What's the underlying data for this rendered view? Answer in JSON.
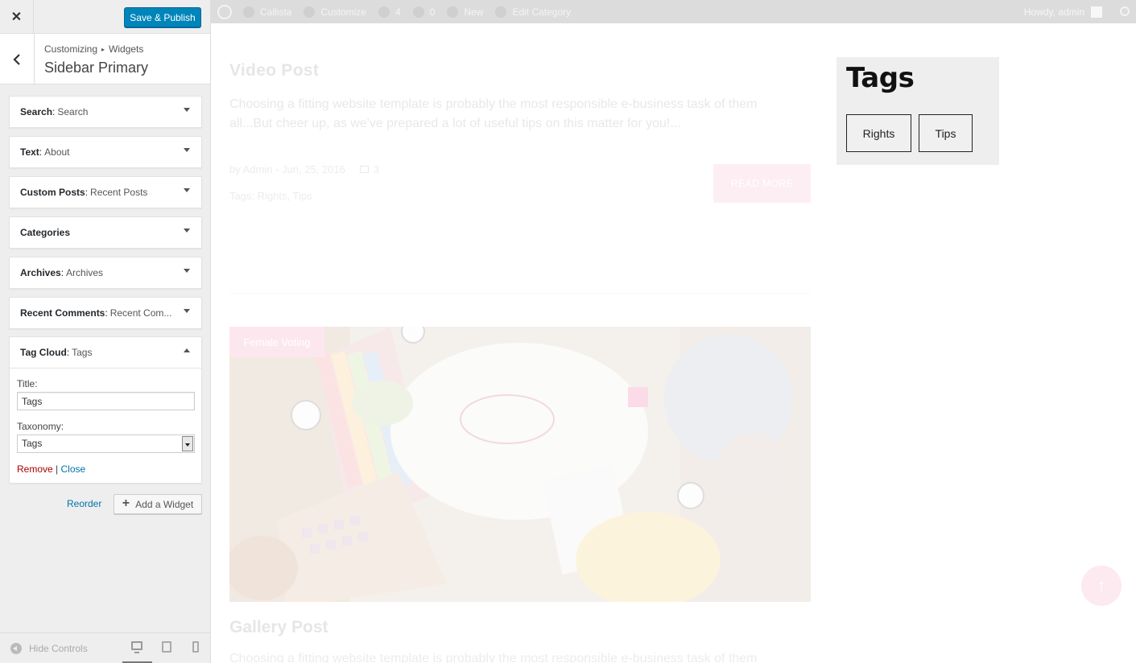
{
  "header": {
    "close_label": "✕",
    "save_label": "Save & Publish"
  },
  "section": {
    "breadcrumb_root": "Customizing",
    "breadcrumb_sep": "▸",
    "breadcrumb_child": "Widgets",
    "title": "Sidebar Primary"
  },
  "widgets": [
    {
      "type": "Search",
      "title": "Search"
    },
    {
      "type": "Text",
      "title": "About"
    },
    {
      "type": "Custom Posts",
      "title": "Recent Posts"
    },
    {
      "type": "Categories",
      "title": ""
    },
    {
      "type": "Archives",
      "title": "Archives"
    },
    {
      "type": "Recent Comments",
      "title": "Recent Com..."
    },
    {
      "type": "Tag Cloud",
      "title": "Tags"
    }
  ],
  "tagcloud_form": {
    "title_label": "Title:",
    "title_value": "Tags",
    "taxonomy_label": "Taxonomy:",
    "taxonomy_value": "Tags",
    "remove_label": "Remove",
    "separator": "|",
    "close_label": "Close"
  },
  "actions": {
    "reorder_label": "Reorder",
    "add_widget_label": "Add a Widget"
  },
  "footer": {
    "hide_controls_label": "Hide Controls"
  },
  "adminbar": {
    "site_name": "Callista",
    "customize": "Customize",
    "updates_count": "4",
    "comments_count": "0",
    "new_label": "New",
    "edit_label": "Edit Category",
    "howdy": "Howdy, admin"
  },
  "post": {
    "title": "Video Post",
    "excerpt": "Choosing a fitting website template is probably the most responsible e-business task of them all...But cheer up, as we've prepared a lot of useful tips on this matter for you!...",
    "meta": "by Admin - Jun, 25, 2016",
    "comments": "3",
    "tags_line": "Tags: Rights, Tips",
    "read_more": "READ MORE",
    "category_badge": "Female Voting"
  },
  "gallery": {
    "title": "Gallery Post",
    "excerpt": "Choosing a fitting website template is probably the most responsible e-business task of them"
  },
  "tags_widget": {
    "title": "Tags",
    "tags": [
      "Rights",
      "Tips"
    ]
  },
  "colors": {
    "primary_button": "#0085ba",
    "link": "#0073aa",
    "remove_link": "#a00000",
    "accent_pink": "#fde9f0"
  }
}
